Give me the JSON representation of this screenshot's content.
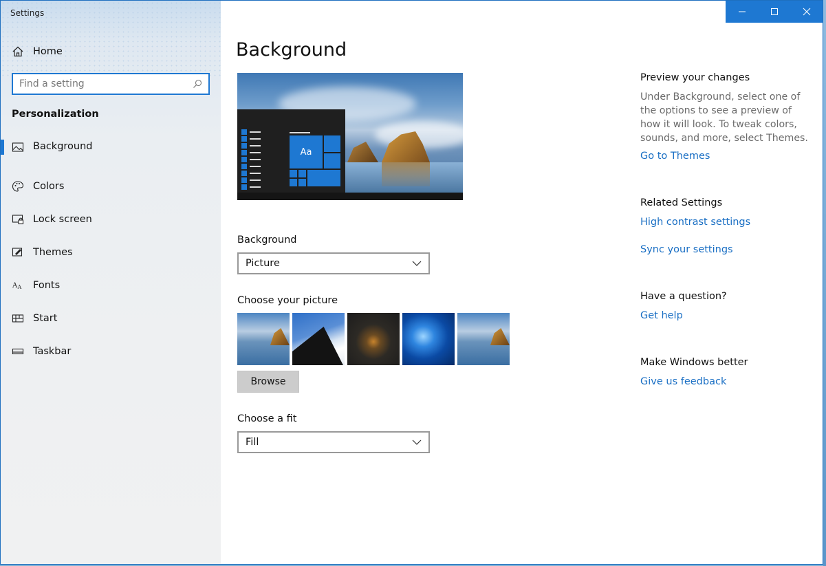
{
  "window": {
    "title": "Settings"
  },
  "sidebar": {
    "home_label": "Home",
    "search_placeholder": "Find a setting",
    "section_title": "Personalization",
    "items": [
      {
        "label": "Background",
        "icon": "picture-icon",
        "active": true
      },
      {
        "label": "Colors",
        "icon": "palette-icon",
        "active": false
      },
      {
        "label": "Lock screen",
        "icon": "lock-screen-icon",
        "active": false
      },
      {
        "label": "Themes",
        "icon": "brush-icon",
        "active": false
      },
      {
        "label": "Fonts",
        "icon": "fonts-icon",
        "active": false
      },
      {
        "label": "Start",
        "icon": "start-icon",
        "active": false
      },
      {
        "label": "Taskbar",
        "icon": "taskbar-icon",
        "active": false
      }
    ]
  },
  "titlebar": {
    "accent": "#1e78d2"
  },
  "main": {
    "title": "Background",
    "preview_tile_text": "Aa",
    "background_label": "Background",
    "background_value": "Picture",
    "choose_picture_label": "Choose your picture",
    "browse_label": "Browse",
    "fit_label": "Choose a fit",
    "fit_value": "Fill"
  },
  "right": {
    "preview_heading": "Preview your changes",
    "preview_text": "Under Background, select one of the options to see a preview of how it will look. To tweak colors, sounds, and more, select Themes.",
    "themes_link": "Go to Themes",
    "related_heading": "Related Settings",
    "contrast_link": "High contrast settings",
    "sync_link": "Sync your settings",
    "question_heading": "Have a question?",
    "help_link": "Get help",
    "better_heading": "Make Windows better",
    "feedback_link": "Give us feedback",
    "link_color": "#1a6fc4"
  }
}
